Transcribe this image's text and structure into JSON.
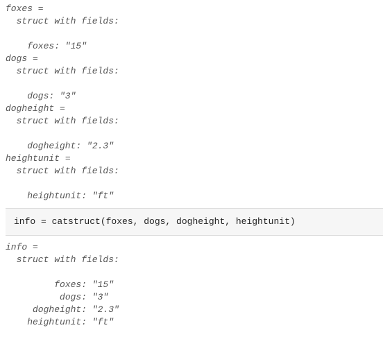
{
  "output1": {
    "foxes": {
      "header": "foxes = ",
      "sub": "struct with fields:",
      "field": "foxes: \"15\""
    },
    "dogs": {
      "header": "dogs = ",
      "sub": "struct with fields:",
      "field": "dogs: \"3\""
    },
    "dogheight": {
      "header": "dogheight = ",
      "sub": "struct with fields:",
      "field": "dogheight: \"2.3\""
    },
    "heightunit": {
      "header": "heightunit = ",
      "sub": "struct with fields:",
      "field": "heightunit: \"ft\""
    }
  },
  "code": {
    "line": "info = catstruct(foxes, dogs, dogheight, heightunit)"
  },
  "output2": {
    "header": "info = ",
    "sub": "struct with fields:",
    "fields": {
      "foxes": "         foxes: \"15\"",
      "dogs": "          dogs: \"3\"",
      "dogheight": "     dogheight: \"2.3\"",
      "heightunit": "    heightunit: \"ft\""
    }
  }
}
